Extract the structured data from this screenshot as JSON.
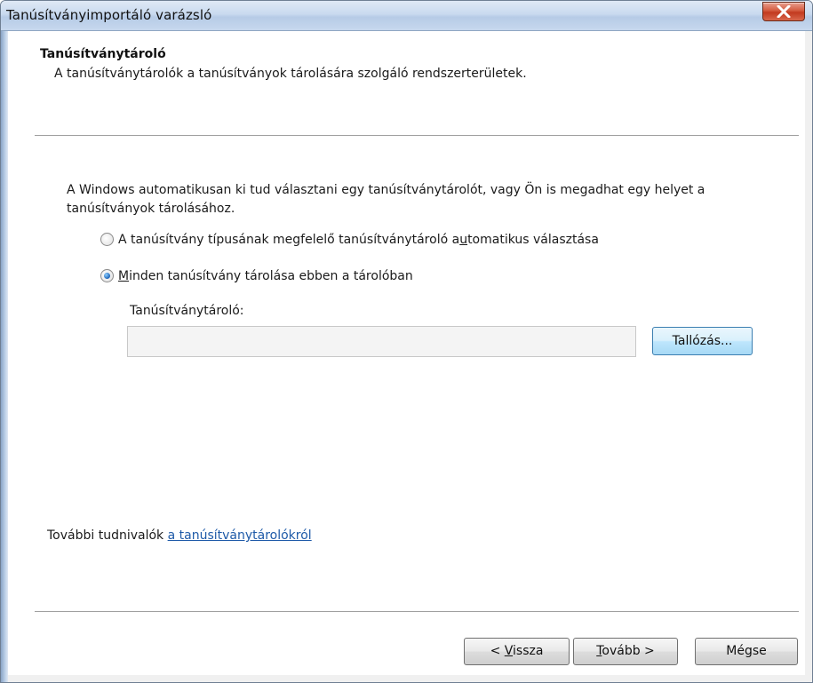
{
  "window": {
    "title": "Tanúsítványimportáló varázsló",
    "close_icon": "close-x-icon"
  },
  "header": {
    "title": "Tanúsítványtároló",
    "description": "A tanúsítványtárolók a tanúsítványok tárolására szolgáló rendszerterületek."
  },
  "body": {
    "intro": "A Windows automatikusan ki tud választani egy tanúsítványtárolót, vagy Ön is megadhat egy helyet a tanúsítványok tárolásához.",
    "options": [
      {
        "label_before": "A tanúsítvány típusának megfelelő tanúsítványtároló a",
        "accel": "u",
        "label_after": "tomatikus választása",
        "selected": false
      },
      {
        "label_before": "",
        "accel": "M",
        "label_after": "inden tanúsítvány tárolása ebben a tárolóban",
        "selected": true
      }
    ],
    "store_label": "Tanúsítványtároló:",
    "store_value": "",
    "browse_label": "Tallózás..."
  },
  "footer": {
    "prefix": "További tudnivalók ",
    "link": "a tanúsítványtárolókról"
  },
  "buttons": {
    "back": {
      "pre": "< ",
      "accel": "V",
      "post": "issza"
    },
    "next": {
      "pre": "",
      "accel": "T",
      "post": "ovább >"
    },
    "cancel": "Mégse"
  }
}
